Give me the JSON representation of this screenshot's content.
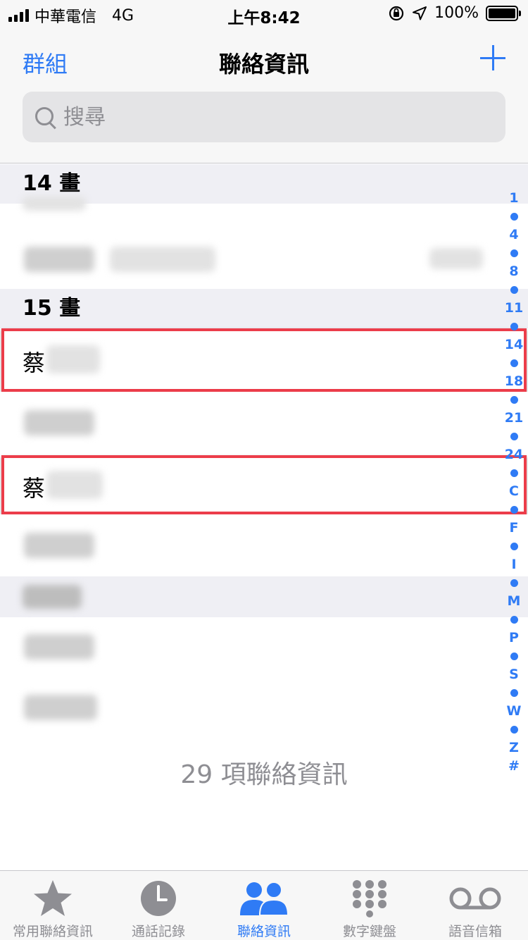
{
  "status_bar": {
    "carrier": "中華電信",
    "network": "4G",
    "time": "上午8:42",
    "battery": "100%"
  },
  "nav": {
    "left_label": "群組",
    "title": "聯絡資訊",
    "add_icon": "plus-icon"
  },
  "search": {
    "placeholder": "搜尋"
  },
  "sections": [
    {
      "header": "14 畫"
    },
    {
      "header": "15 畫"
    }
  ],
  "contacts": [
    {
      "visible_name": "蔡"
    },
    {
      "visible_name": "蔡"
    }
  ],
  "index": [
    "1",
    "4",
    "8",
    "11",
    "14",
    "18",
    "21",
    "24",
    "C",
    "F",
    "I",
    "M",
    "P",
    "S",
    "W",
    "Z",
    "#"
  ],
  "footer": {
    "count": "29 項聯絡資訊"
  },
  "tabbar": {
    "tabs": [
      {
        "label": "常用聯絡資訊",
        "icon": "star-icon",
        "active": false
      },
      {
        "label": "通話記錄",
        "icon": "clock-icon",
        "active": false
      },
      {
        "label": "聯絡資訊",
        "icon": "people-icon",
        "active": true
      },
      {
        "label": "數字鍵盤",
        "icon": "keypad-icon",
        "active": false
      },
      {
        "label": "語音信箱",
        "icon": "voicemail-icon",
        "active": false
      }
    ]
  },
  "colors": {
    "accent": "#2f7bf5",
    "highlight": "#ec3d4a",
    "inactive": "#8e8e93"
  }
}
